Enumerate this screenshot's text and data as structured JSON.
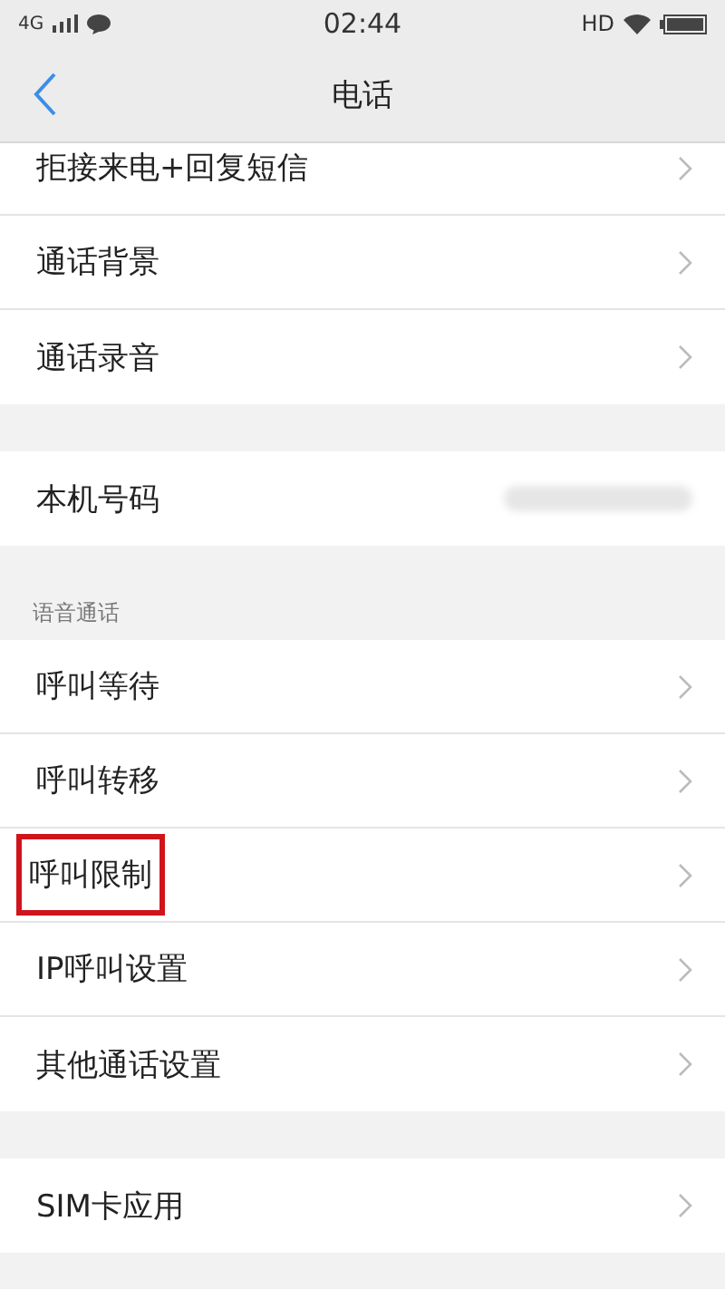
{
  "status_bar": {
    "network": "4G",
    "time": "02:44",
    "hd": "HD"
  },
  "header": {
    "title": "电话"
  },
  "sections": [
    {
      "rows": [
        {
          "label": "拒接来电+回复短信",
          "kind": "link",
          "highlighted": false
        },
        {
          "label": "通话背景",
          "kind": "link",
          "highlighted": false
        },
        {
          "label": "通话录音",
          "kind": "link",
          "highlighted": false
        }
      ]
    },
    {
      "rows": [
        {
          "label": "本机号码",
          "kind": "value",
          "highlighted": false
        }
      ]
    },
    {
      "title": "语音通话",
      "rows": [
        {
          "label": "呼叫等待",
          "kind": "link",
          "highlighted": false
        },
        {
          "label": "呼叫转移",
          "kind": "link",
          "highlighted": false
        },
        {
          "label": "呼叫限制",
          "kind": "link",
          "highlighted": true
        },
        {
          "label": "IP呼叫设置",
          "kind": "link",
          "highlighted": false
        },
        {
          "label": "其他通话设置",
          "kind": "link",
          "highlighted": false
        }
      ]
    },
    {
      "rows": [
        {
          "label": "SIM卡应用",
          "kind": "link",
          "highlighted": false
        }
      ]
    }
  ]
}
